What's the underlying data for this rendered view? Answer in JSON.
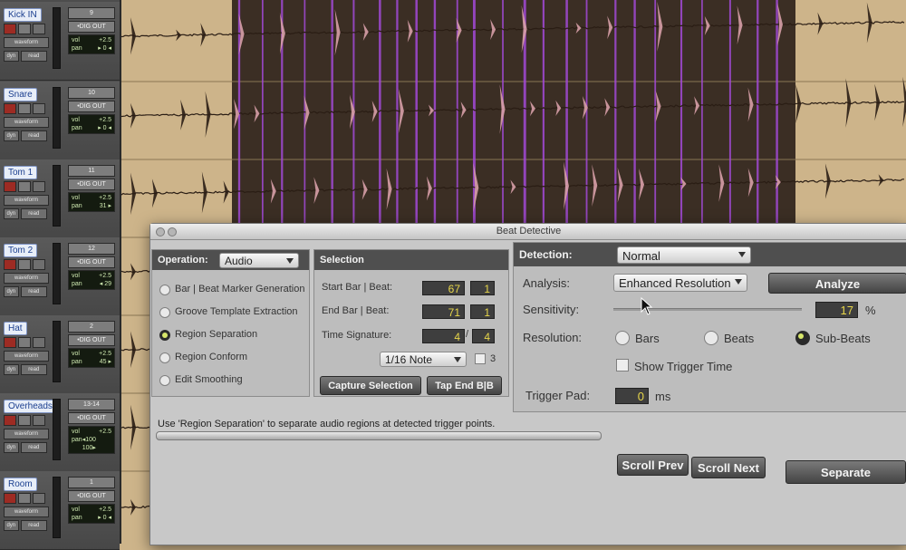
{
  "tracks": [
    {
      "name": "Kick IN",
      "io_num": "9",
      "output": "•DIG OUT",
      "vol": "+2.5",
      "pan": "▸ 0 ◂",
      "view": "waveform",
      "dyn": "dyn",
      "auto": "read"
    },
    {
      "name": "Snare",
      "io_num": "10",
      "output": "•DIG OUT",
      "vol": "+2.5",
      "pan": "▸ 0 ◂",
      "view": "waveform",
      "dyn": "dyn",
      "auto": "read"
    },
    {
      "name": "Tom 1",
      "io_num": "11",
      "output": "•DIG OUT",
      "vol": "+2.5",
      "pan": "31 ▸",
      "view": "waveform",
      "dyn": "dyn",
      "auto": "read"
    },
    {
      "name": "Tom 2",
      "io_num": "12",
      "output": "•DIG OUT",
      "vol": "+2.5",
      "pan": "◂ 29",
      "view": "waveform",
      "dyn": "dyn",
      "auto": "read"
    },
    {
      "name": "Hat",
      "io_num": "2",
      "output": "•DIG OUT",
      "vol": "+2.5",
      "pan": "45 ▸",
      "view": "waveform",
      "dyn": "dyn",
      "auto": "read"
    },
    {
      "name": "Overheads",
      "io_num": "13-14",
      "output": "•DIG OUT",
      "vol": "+2.5",
      "pan": "◂100  100▸",
      "view": "waveform",
      "dyn": "dyn",
      "auto": "read"
    },
    {
      "name": "Room",
      "io_num": "1",
      "output": "•DIG OUT",
      "vol": "+2.5",
      "pan": "▸ 0 ◂",
      "view": "waveform",
      "dyn": "dyn",
      "auto": "read"
    }
  ],
  "track_labels": {
    "vol": "vol",
    "pan": "pan"
  },
  "window": {
    "title": "Beat Detective"
  },
  "operation": {
    "label": "Operation:",
    "value": "Audio",
    "options": [
      {
        "label": "Bar | Beat Marker Generation",
        "selected": false
      },
      {
        "label": "Groove Template Extraction",
        "selected": false
      },
      {
        "label": "Region Separation",
        "selected": true
      },
      {
        "label": "Region Conform",
        "selected": false
      },
      {
        "label": "Edit Smoothing",
        "selected": false
      }
    ]
  },
  "selection": {
    "header": "Selection",
    "start_label": "Start Bar | Beat:",
    "start_bar": "67",
    "start_beat": "1",
    "end_label": "End Bar | Beat:",
    "end_bar": "71",
    "end_beat": "1",
    "ts_label": "Time Signature:",
    "ts_num": "4",
    "ts_slash": "/",
    "ts_den": "4",
    "note_value": "1/16 Note",
    "triplet_label": "3",
    "capture_button": "Capture Selection",
    "tap_button": "Tap End B|B"
  },
  "detection": {
    "label": "Detection:",
    "mode": "Normal",
    "analysis_label": "Analysis:",
    "analysis_value": "Enhanced Resolution",
    "analyze_button": "Analyze",
    "sensitivity_label": "Sensitivity:",
    "sensitivity_value": "17",
    "sensitivity_unit": "%",
    "resolution_label": "Resolution:",
    "resolution_options": [
      {
        "label": "Bars",
        "selected": false
      },
      {
        "label": "Beats",
        "selected": false
      },
      {
        "label": "Sub-Beats",
        "selected": true
      }
    ],
    "show_trigger_label": "Show Trigger Time",
    "trigger_pad_label": "Trigger Pad:",
    "trigger_pad_value": "0",
    "trigger_pad_unit": "ms"
  },
  "status_message": "Use 'Region Separation' to separate audio regions at detected trigger points.",
  "buttons": {
    "scroll_prev": "Scroll Prev",
    "scroll_next": "Scroll Next",
    "separate": "Separate"
  },
  "colors": {
    "selection": "#3b2e24",
    "trigger_line": "#a24ad6",
    "waveform_dark": "#2a1d14",
    "waveform_pink": "#d8a0a8",
    "region_bg": "#cdb48a"
  }
}
